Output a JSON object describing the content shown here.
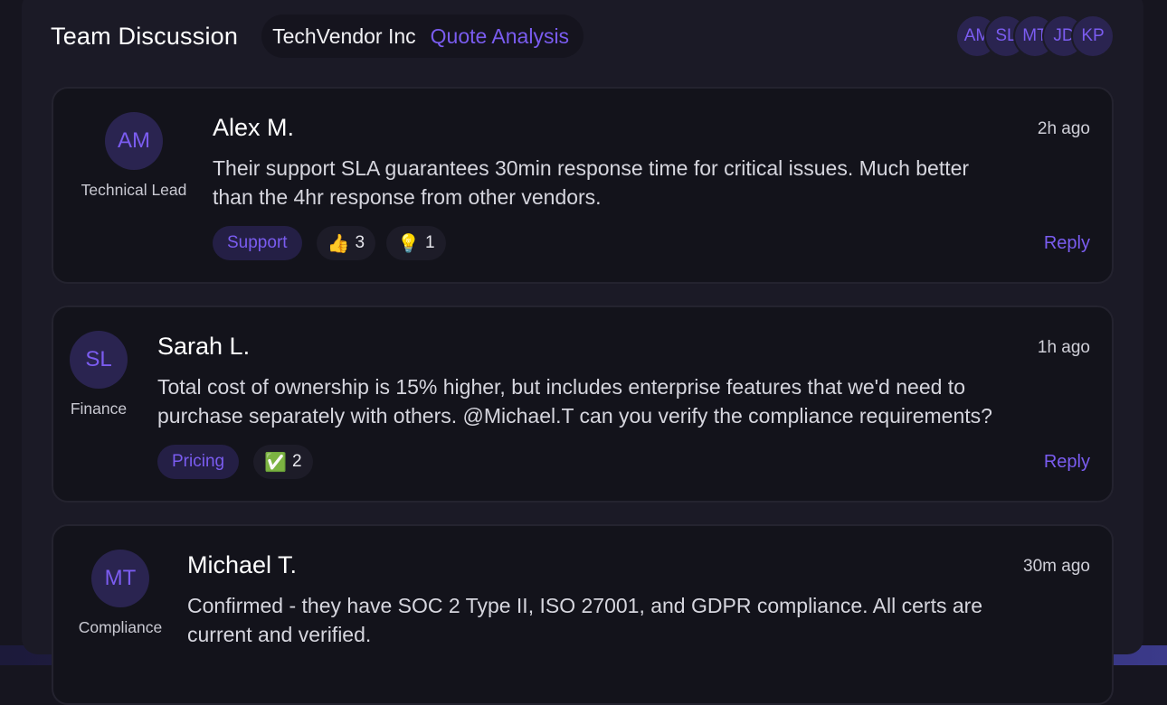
{
  "header": {
    "title": "Team Discussion",
    "vendor": "TechVendor Inc",
    "analysis": "Quote Analysis",
    "participants": [
      "AM",
      "SL",
      "MT",
      "JD",
      "KP"
    ]
  },
  "messages": [
    {
      "initials": "AM",
      "role": "Technical Lead",
      "name": "Alex M.",
      "time": "2h ago",
      "body_line1": "Their support SLA guarantees 30min response time for critical issues. Much better",
      "body_line2": "than the 4hr response from other vendors.",
      "tag": "Support",
      "reactions": [
        {
          "emoji": "👍",
          "count": "3",
          "icon": "thumbs-up-icon"
        },
        {
          "emoji": "💡",
          "count": "1",
          "icon": "lightbulb-icon"
        }
      ],
      "reply_label": "Reply"
    },
    {
      "initials": "SL",
      "role": "Finance",
      "name": "Sarah L.",
      "time": "1h ago",
      "body_line1": "Total cost of ownership is 15% higher, but includes enterprise features that we'd need to",
      "body_line2": "purchase separately with others. @Michael.T can you verify the compliance requirements?",
      "tag": "Pricing",
      "reactions": [
        {
          "emoji": "✅",
          "count": "2",
          "icon": "check-mark-icon"
        }
      ],
      "reply_label": "Reply"
    },
    {
      "initials": "MT",
      "role": "Compliance",
      "name": "Michael T.",
      "time": "30m ago",
      "body_line1": "Confirmed - they have SOC 2 Type II, ISO 27001, and GDPR compliance. All certs are",
      "body_line2": "current and verified."
    }
  ],
  "colors": {
    "accent": "#7a5cf0",
    "panel": "#1b1a26",
    "card": "#13131b",
    "tag_bg": "#241f45"
  }
}
